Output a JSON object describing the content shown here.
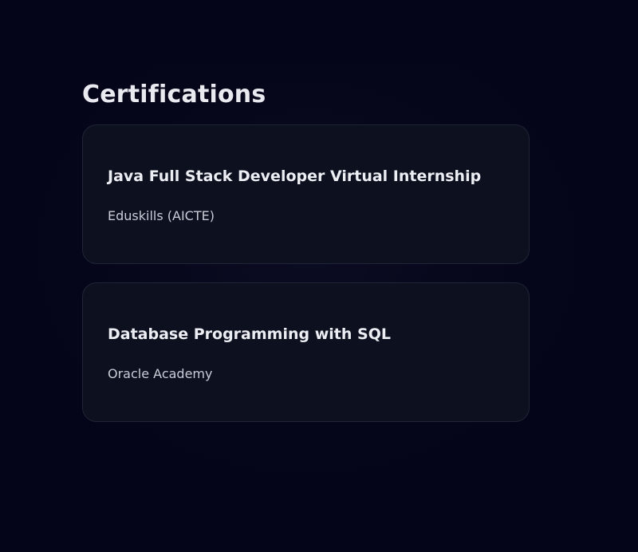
{
  "section": {
    "title": "Certifications"
  },
  "certifications": [
    {
      "title": "Java Full Stack Developer Virtual Internship",
      "issuer": "Eduskills (AICTE)"
    },
    {
      "title": "Database Programming with SQL",
      "issuer": "Oracle Academy"
    }
  ],
  "colors": {
    "background": "#05051a",
    "card_background": "#0d111f",
    "card_border": "#1f2436",
    "title_text": "#e8eaf0",
    "issuer_text": "#c9ccd6"
  }
}
